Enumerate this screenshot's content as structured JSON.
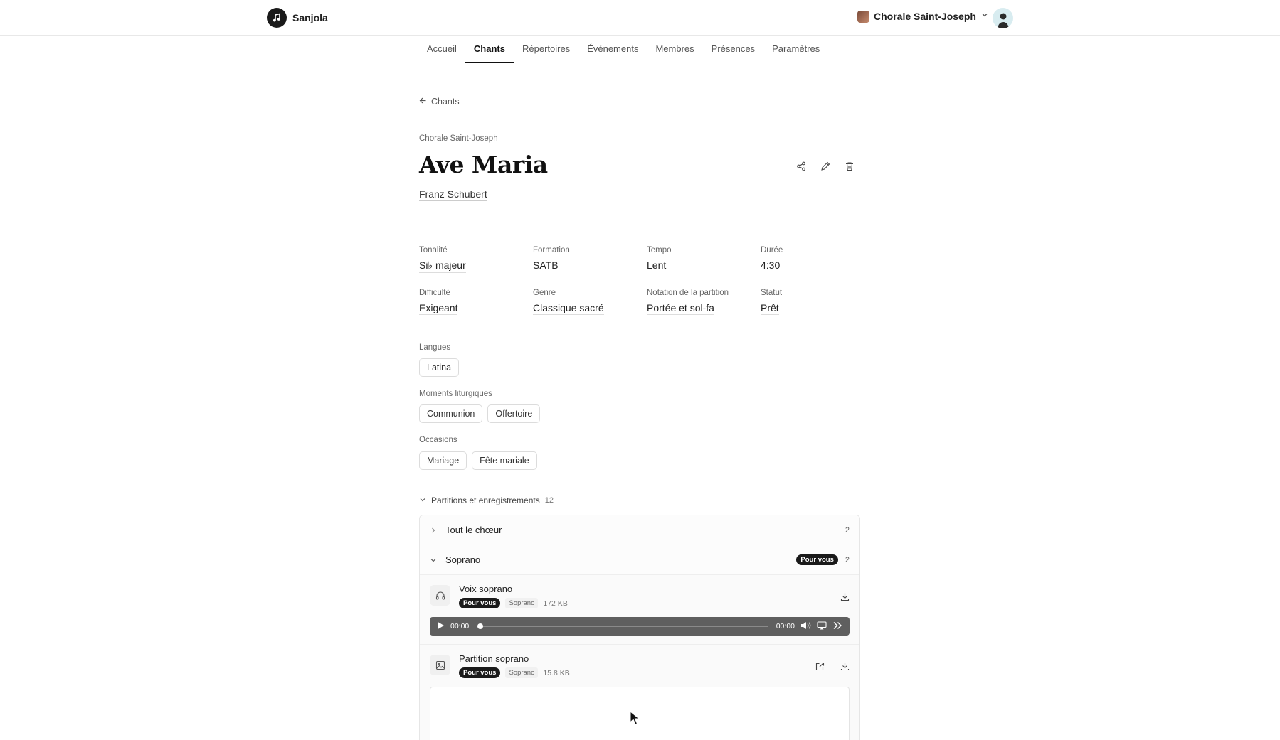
{
  "brand": {
    "name": "Sanjola"
  },
  "choir_switcher": {
    "name": "Chorale Saint-Joseph"
  },
  "nav": {
    "tabs": [
      "Accueil",
      "Chants",
      "Répertoires",
      "Événements",
      "Membres",
      "Présences",
      "Paramètres"
    ],
    "active": "Chants"
  },
  "back_link": "Chants",
  "song": {
    "choir": "Chorale Saint-Joseph",
    "title": "Ave Maria",
    "composer": "Franz Schubert"
  },
  "meta": [
    {
      "key": "Tonalité",
      "value": "Si♭ majeur"
    },
    {
      "key": "Formation",
      "value": "SATB"
    },
    {
      "key": "Tempo",
      "value": "Lent"
    },
    {
      "key": "Durée",
      "value": "4:30"
    },
    {
      "key": "Difficulté",
      "value": "Exigeant"
    },
    {
      "key": "Genre",
      "value": "Classique sacré"
    },
    {
      "key": "Notation de la partition",
      "value": "Portée et sol-fa"
    },
    {
      "key": "Statut",
      "value": "Prêt"
    }
  ],
  "tag_groups": [
    {
      "label": "Langues",
      "tags": [
        "Latina"
      ]
    },
    {
      "label": "Moments liturgiques",
      "tags": [
        "Communion",
        "Offertoire"
      ]
    },
    {
      "label": "Occasions",
      "tags": [
        "Mariage",
        "Fête mariale"
      ]
    }
  ],
  "files_section": {
    "title": "Partitions et enregistrements",
    "count": "12",
    "groups": [
      {
        "name": "Tout le chœur",
        "count": "2",
        "expanded": false
      },
      {
        "name": "Soprano",
        "count": "2",
        "expanded": true,
        "badge": "Pour vous"
      }
    ],
    "items": [
      {
        "title": "Voix soprano",
        "badge": "Pour vous",
        "part": "Soprano",
        "size": "172 KB",
        "icon": "headphones-icon",
        "player": {
          "current": "00:00",
          "total": "00:00"
        }
      },
      {
        "title": "Partition soprano",
        "badge": "Pour vous",
        "part": "Soprano",
        "size": "15.8 KB",
        "icon": "image-icon"
      }
    ]
  }
}
